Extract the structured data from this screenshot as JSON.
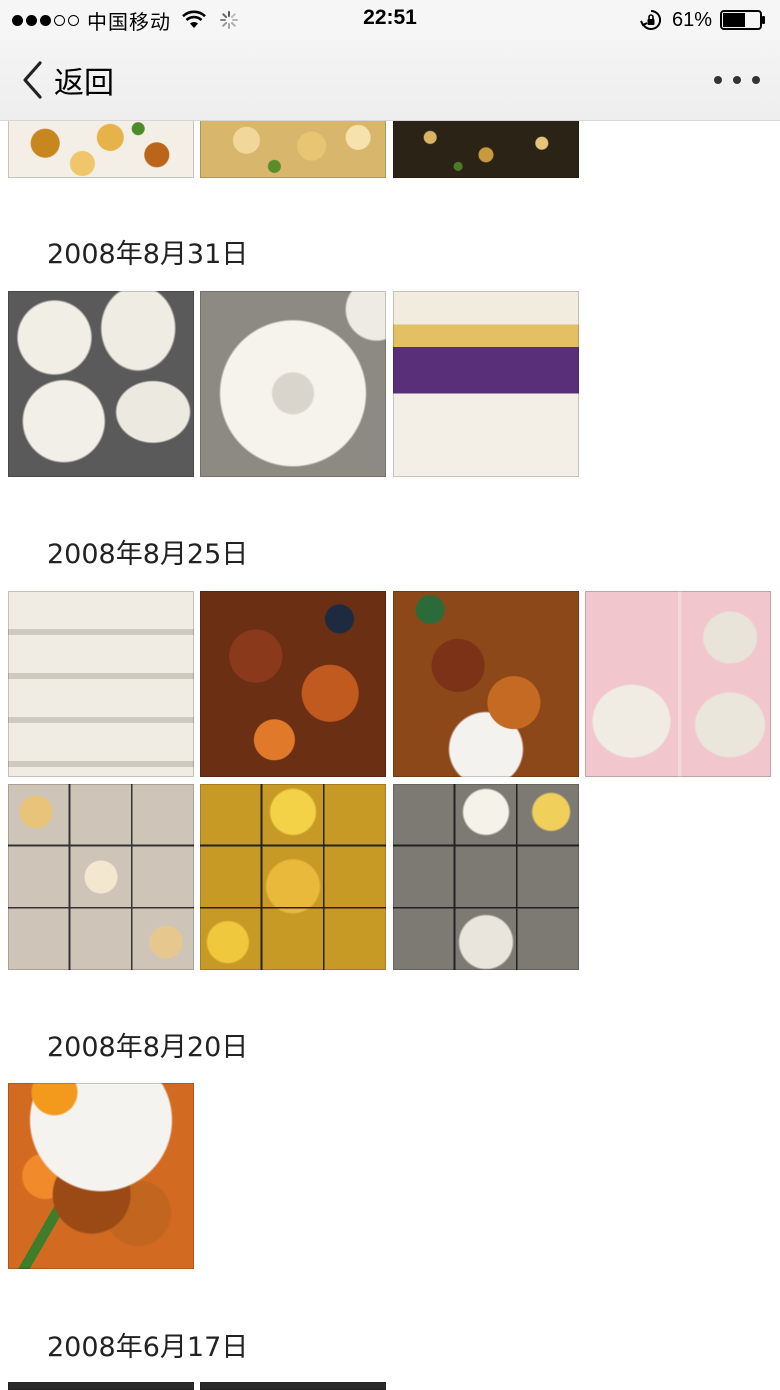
{
  "status_bar": {
    "carrier": "中国移动",
    "time": "22:51",
    "battery_percent": "61%",
    "battery_level": 0.61,
    "signal_bars_filled": 3,
    "signal_bars_total": 5
  },
  "nav": {
    "back_label": "返回",
    "more_icon": "more-dots-icon",
    "back_icon": "chevron-left-icon"
  },
  "sections": [
    {
      "date": "2008年8月31日"
    },
    {
      "date": "2008年8月25日"
    },
    {
      "date": "2008年8月20日"
    },
    {
      "date": "2008年6月17日"
    }
  ]
}
